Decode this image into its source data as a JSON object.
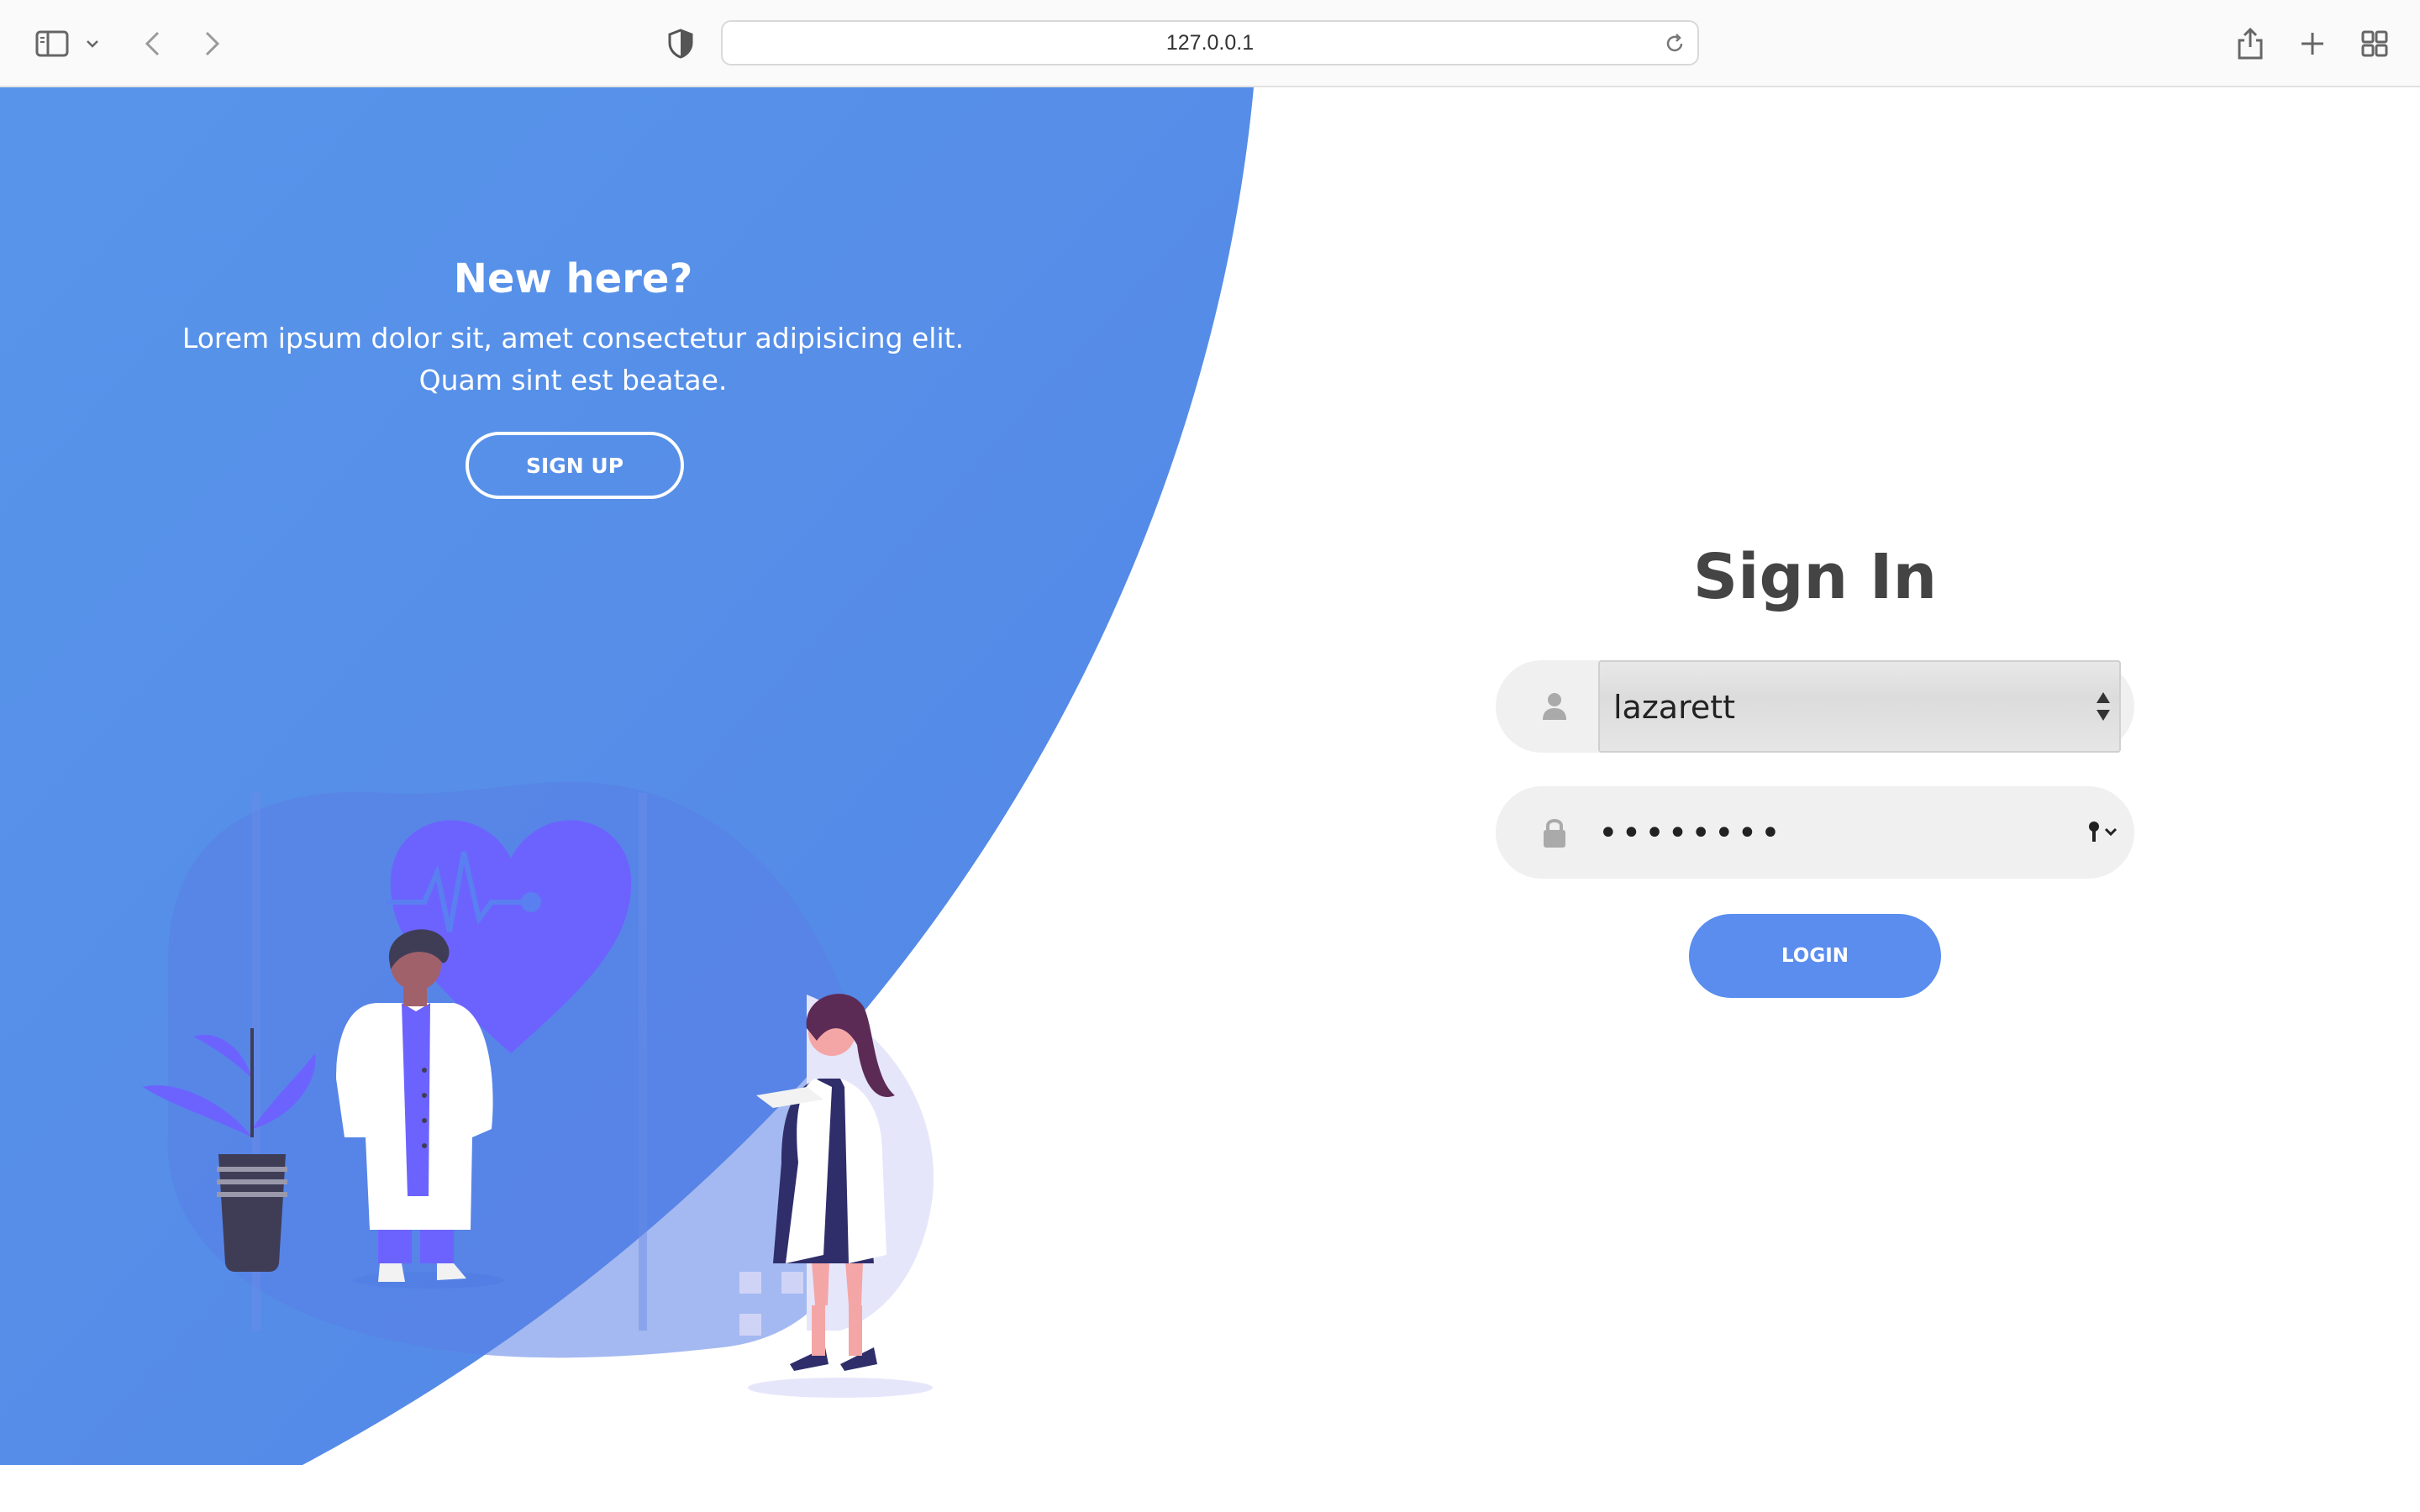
{
  "browser": {
    "url": "127.0.0.1",
    "icons": [
      "sidebar-icon",
      "chevron-down-icon",
      "back-icon",
      "forward-icon",
      "privacy-shield-icon",
      "reload-icon",
      "share-icon",
      "new-tab-icon",
      "tab-overview-icon"
    ]
  },
  "promo": {
    "title": "New here?",
    "text": "Lorem ipsum dolor sit, amet consectetur adipisicing elit. Quam sint est beatae.",
    "signup_label": "SIGN UP"
  },
  "signin": {
    "title": "Sign In",
    "username_value": "lazarett",
    "password_value": "••••••••",
    "login_label": "LOGIN"
  },
  "colors": {
    "primary_blue": "#5b8def",
    "field_bg": "#f0f0f0",
    "title_text": "#444444"
  }
}
